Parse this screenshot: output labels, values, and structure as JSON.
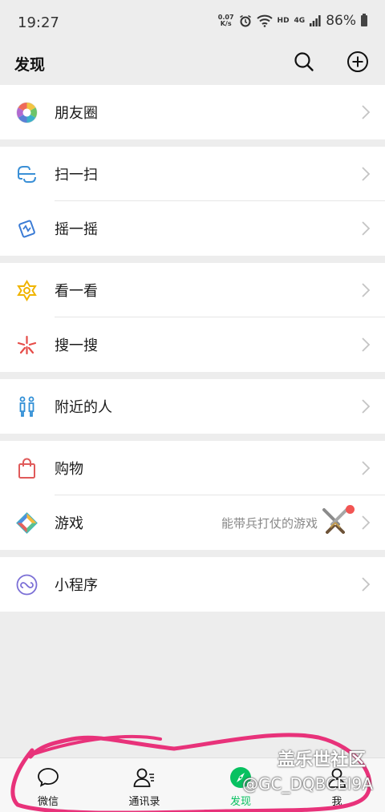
{
  "status_bar": {
    "time": "19:27",
    "net_speed_value": "0.07",
    "net_speed_unit": "K/s",
    "hd_label": "HD",
    "network_label": "4G",
    "battery_percent": "86%"
  },
  "header": {
    "title": "发现",
    "search_icon": "search-icon",
    "add_icon": "plus-circle-icon"
  },
  "menu": {
    "moments": {
      "label": "朋友圈",
      "icon": "moments-aperture-icon"
    },
    "scan": {
      "label": "扫一扫",
      "icon": "scan-icon"
    },
    "shake": {
      "label": "摇一摇",
      "icon": "shake-icon"
    },
    "top_stories": {
      "label": "看一看",
      "icon": "top-stories-icon"
    },
    "search": {
      "label": "搜一搜",
      "icon": "search-sparkle-icon"
    },
    "nearby": {
      "label": "附近的人",
      "icon": "people-nearby-icon"
    },
    "shopping": {
      "label": "购物",
      "icon": "shopping-bag-icon"
    },
    "games": {
      "label": "游戏",
      "icon": "games-diamond-icon",
      "description": "能带兵打仗的游戏"
    },
    "mini_programs": {
      "label": "小程序",
      "icon": "mini-program-icon"
    }
  },
  "tabbar": {
    "chats": {
      "label": "微信",
      "icon": "chat-bubble-icon"
    },
    "contacts": {
      "label": "通讯录",
      "icon": "contacts-icon"
    },
    "discover": {
      "label": "发现",
      "icon": "compass-icon",
      "active": true
    },
    "me": {
      "label": "我",
      "icon": "person-icon"
    }
  },
  "watermark": {
    "line1": "盖乐世社区",
    "line2": "@GC_DQBCEI9A"
  },
  "colors": {
    "accent": "#07c160",
    "background": "#ededed",
    "annotation": "#e8327a",
    "badge": "#f25553"
  }
}
